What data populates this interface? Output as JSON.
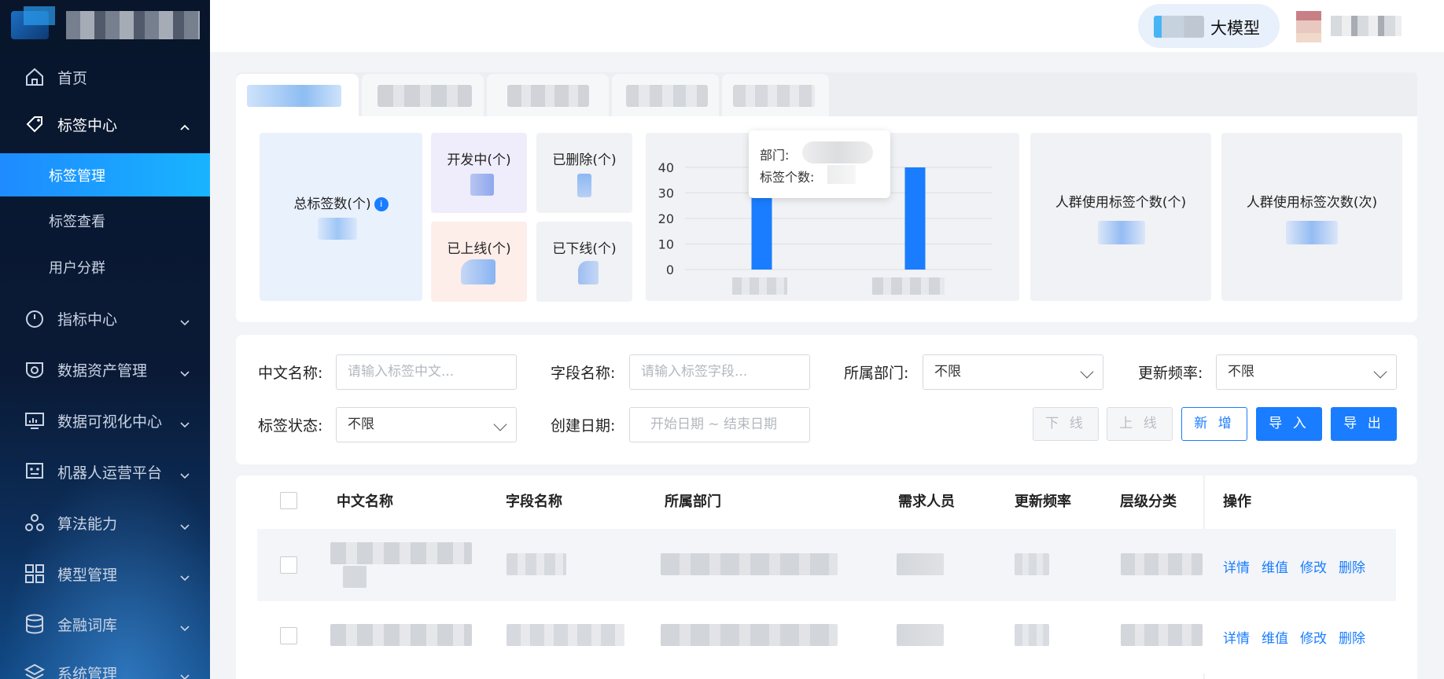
{
  "sidebar": {
    "items": [
      {
        "label": "首页",
        "icon": "home-icon"
      },
      {
        "label": "标签中心",
        "icon": "tag-icon",
        "expanded": true
      },
      {
        "label": "指标中心",
        "icon": "gauge-icon"
      },
      {
        "label": "数据资产管理",
        "icon": "asset-icon"
      },
      {
        "label": "数据可视化中心",
        "icon": "monitor-icon"
      },
      {
        "label": "机器人运营平台",
        "icon": "robot-icon"
      },
      {
        "label": "算法能力",
        "icon": "algorithm-icon"
      },
      {
        "label": "模型管理",
        "icon": "grid-icon"
      },
      {
        "label": "金融词库",
        "icon": "database-icon"
      },
      {
        "label": "系统管理",
        "icon": "layers-icon"
      }
    ],
    "sub_items": [
      {
        "label": "标签管理",
        "active": true
      },
      {
        "label": "标签查看"
      },
      {
        "label": "用户分群"
      }
    ]
  },
  "header": {
    "brand_label": "大模型"
  },
  "stats": {
    "total_label": "总标签数(个)",
    "info_mark": "i",
    "developing_label": "开发中(个)",
    "deleted_label": "已删除(个)",
    "online_label": "已上线(个)",
    "offline_label": "已下线(个)",
    "crowd_tags_label": "人群使用标签个数(个)",
    "crowd_times_label": "人群使用标签次数(次)"
  },
  "tooltip": {
    "dept_label": "部门:",
    "count_label": "标签个数:"
  },
  "chart_data": {
    "type": "bar",
    "categories": [
      "",
      ""
    ],
    "values": [
      36,
      40
    ],
    "ylim": [
      0,
      40
    ],
    "yticks": [
      0,
      10,
      20,
      30,
      40
    ],
    "grid": true,
    "color": "#1a7dff"
  },
  "filters": {
    "cn_name_label": "中文名称:",
    "cn_name_placeholder": "请输入标签中文...",
    "field_name_label": "字段名称:",
    "field_name_placeholder": "请输入标签字段...",
    "dept_label": "所属部门:",
    "dept_value": "不限",
    "freq_label": "更新频率:",
    "freq_value": "不限",
    "status_label": "标签状态:",
    "status_value": "不限",
    "date_label": "创建日期:",
    "date_placeholder": "开始日期 ~ 结束日期"
  },
  "buttons": {
    "offline": "下 线",
    "online": "上 线",
    "add": "新 增",
    "import": "导 入",
    "export": "导 出"
  },
  "table": {
    "columns": [
      "中文名称",
      "字段名称",
      "所属部门",
      "需求人员",
      "更新频率",
      "层级分类",
      "操作"
    ],
    "actions": [
      "详情",
      "维值",
      "修改",
      "删除"
    ]
  },
  "colors": {
    "accent": "#1a7dff",
    "sidebar_bg": "#08152b"
  }
}
